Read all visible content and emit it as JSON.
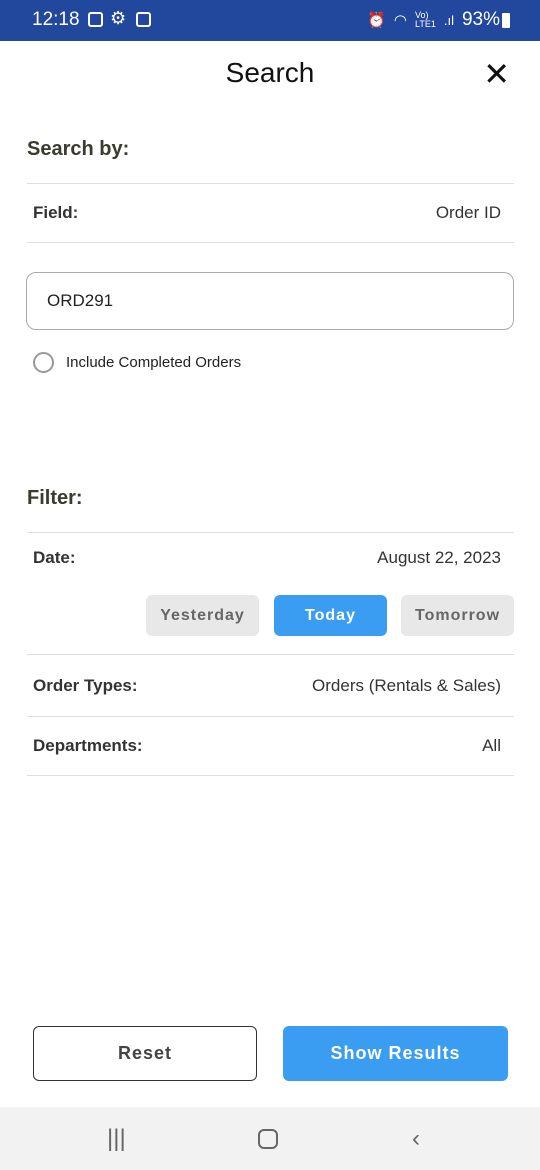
{
  "status_bar": {
    "time": "12:18",
    "battery": "93%",
    "icons": [
      "image-icon",
      "gear-icon",
      "clipboard-icon",
      "alarm-icon",
      "wifi-icon",
      "volte-icon",
      "signal-icon",
      "battery-charging-icon"
    ]
  },
  "header": {
    "title": "Search",
    "close_icon": "close-icon"
  },
  "search_by": {
    "heading": "Search by:",
    "field_label": "Field:",
    "field_value": "Order ID",
    "input_value": "ORD291",
    "include_completed_label": "Include Completed Orders",
    "include_completed_checked": false
  },
  "filter": {
    "heading": "Filter:",
    "date_label": "Date:",
    "date_value": "August 22, 2023",
    "date_buttons": [
      "Yesterday",
      "Today",
      "Tomorrow"
    ],
    "date_selected": "Today",
    "order_types_label": "Order Types:",
    "order_types_value": "Orders (Rentals & Sales)",
    "departments_label": "Departments:",
    "departments_value": "All"
  },
  "actions": {
    "reset": "Reset",
    "show_results": "Show Results"
  },
  "colors": {
    "status_bar": "#21489c",
    "accent": "#3a9df2"
  }
}
